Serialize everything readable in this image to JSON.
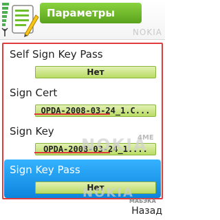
{
  "header": {
    "title": "Параметры",
    "watermark": "NOKIA"
  },
  "list": {
    "items": [
      {
        "label": "Self Sign Key Pass",
        "value": "Нет"
      },
      {
        "label": "Sign Cert",
        "value": "OPDA-2008-03-24_1.C..."
      },
      {
        "label": "Sign Key",
        "value": "OPDA-2008-03-24_1...."
      },
      {
        "label": "Sign Key Pass",
        "value": "Нет"
      }
    ]
  },
  "watermarks": {
    "middle": "NOKIA",
    "middle_suffix": "4ME",
    "bottom": "NOKIA",
    "corner": "МАБЭКА"
  },
  "softkeys": {
    "right": "Назад"
  },
  "colors": {
    "accent_green": "#6cbf2a",
    "selection_blue": "#1a95e8",
    "highlight_red": "#e03a3a"
  }
}
